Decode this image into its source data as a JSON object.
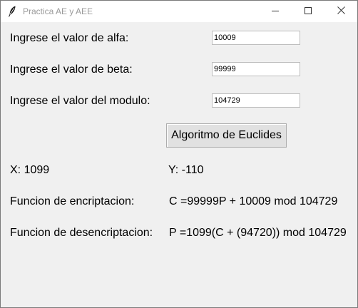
{
  "window": {
    "title": "Practica AE y AEE",
    "icons": {
      "app": "feather-icon",
      "minimize": "minimize-icon",
      "maximize": "maximize-icon",
      "close": "close-icon"
    }
  },
  "form": {
    "alpha_label": "Ingrese el valor de alfa:",
    "alpha_value": "10009",
    "beta_label": "Ingrese el valor de beta:",
    "beta_value": "99999",
    "modulo_label": "Ingrese el valor del modulo:",
    "modulo_value": "104729",
    "button_label": "Algoritmo de Euclides"
  },
  "results": {
    "x": "X: 1099",
    "y": "Y: -110",
    "encrypt_label": "Funcion de encriptacion:",
    "encrypt_value": "C =99999P + 10009 mod 104729",
    "decrypt_label": "Funcion de desencriptacion:",
    "decrypt_value": "P =1099(C + (94720)) mod 104729"
  },
  "colors": {
    "background": "#f0f0f0",
    "titlebar": "#ffffff",
    "button": "#e1e1e1"
  }
}
